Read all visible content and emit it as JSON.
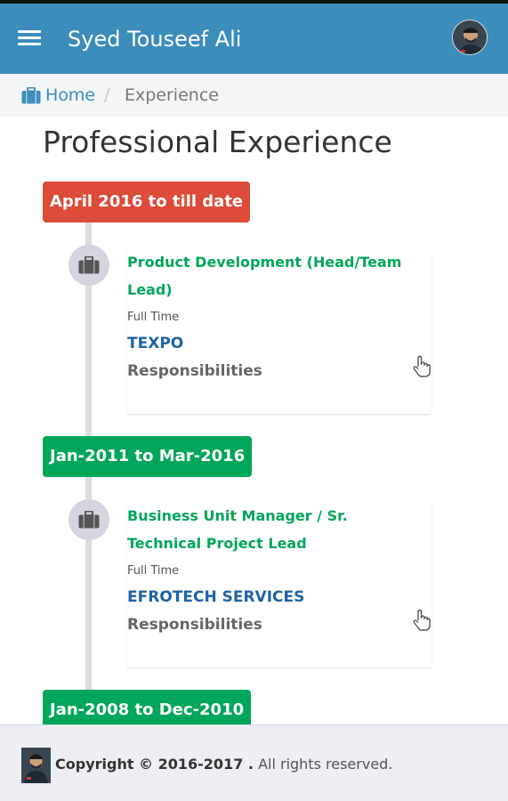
{
  "header": {
    "title": "Syed Touseef Ali",
    "menu_icon": "hamburger-menu-icon",
    "avatar_icon": "user-avatar"
  },
  "breadcrumb": {
    "home_label": "Home",
    "home_icon": "briefcase-icon",
    "separator": "/",
    "current": "Experience"
  },
  "page": {
    "title": "Professional Experience"
  },
  "timeline": [
    {
      "period": "April 2016 to till date",
      "period_color": "#dd4b39",
      "position": "Product Development (Head/Team Lead)",
      "type": "Full Time",
      "company": "TEXPO",
      "responsibilities_label": "Responsibilities",
      "icon": "briefcase-icon"
    },
    {
      "period": "Jan-2011 to Mar-2016",
      "period_color": "#00a65a",
      "position": "Business Unit Manager / Sr. Technical Project Lead",
      "type": "Full Time",
      "company": "EFROTECH SERVICES",
      "responsibilities_label": "Responsibilities",
      "icon": "briefcase-icon"
    },
    {
      "period": "Jan-2008 to Dec-2010",
      "period_color": "#00a65a"
    }
  ],
  "footer": {
    "copyright": "Copyright © 2016-2017 .",
    "rights": "All rights reserved."
  },
  "colors": {
    "navbar": "#3c8dbc",
    "accent_green": "#00a65a",
    "accent_red": "#dd4b39",
    "company_blue": "#1e63a4"
  }
}
